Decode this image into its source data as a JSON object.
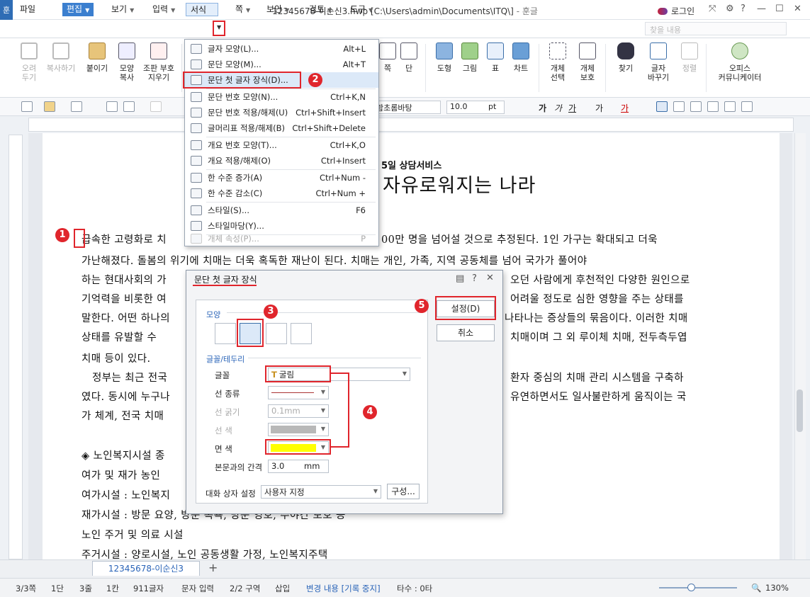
{
  "window": {
    "title_main": "12345678-이순신3.hwp [C:\\Users\\admin\\Documents\\ITQ\\]",
    "title_app": "- 훈글",
    "app_icon": "훈",
    "login": "로그인",
    "controls": [
      "⤧",
      "⚙",
      "?",
      "—",
      "☐",
      "✕"
    ]
  },
  "menu": {
    "items": [
      "파일",
      "편집",
      "보기",
      "입력",
      "서식",
      "쪽",
      "보안",
      "검토",
      "도구"
    ],
    "search_placeholder": "찾을 내용"
  },
  "ribbon": {
    "left": [
      "오려\n두기",
      "복사하기",
      "붙이기",
      "모양\n복사",
      "조판 부호\n지우기"
    ],
    "mid": [
      "쪽",
      "단"
    ],
    "right": [
      "도형",
      "그림",
      "표",
      "차트",
      "개체\n선택",
      "개체\n보호",
      "찾기",
      "글자\n바꾸기",
      "정렬",
      "오피스\n커뮤니케이터"
    ],
    "zoom_icon_label": "fx"
  },
  "format_bar": {
    "font": "함초롬바탕",
    "size": "10.0",
    "unit": "pt",
    "styles": [
      "가",
      "가",
      "가",
      "가",
      "가"
    ]
  },
  "format_menu": {
    "items": [
      {
        "label": "글자 모양(L)...",
        "shortcut": "Alt+L",
        "icon": "font-shape-icon"
      },
      {
        "label": "문단 모양(M)...",
        "shortcut": "Alt+T",
        "icon": "paragraph-shape-icon"
      },
      {
        "label": "문단 첫 글자 장식(D)...",
        "shortcut": "",
        "icon": "drop-cap-icon"
      },
      {
        "label": "문단 번호 모양(N)...",
        "shortcut": "Ctrl+K,N",
        "icon": "paragraph-number-icon"
      },
      {
        "label": "문단 번호 적용/해제(U)",
        "shortcut": "Ctrl+Shift+Insert",
        "icon": "numbering-toggle-icon"
      },
      {
        "label": "글머리표 적용/해제(B)",
        "shortcut": "Ctrl+Shift+Delete",
        "icon": "bullet-toggle-icon"
      },
      {
        "label": "개요 번호 모양(T)...",
        "shortcut": "Ctrl+K,O",
        "icon": "outline-number-icon"
      },
      {
        "label": "개요 적용/해제(O)",
        "shortcut": "Ctrl+Insert",
        "icon": "outline-toggle-icon"
      },
      {
        "label": "한 수준 증가(A)",
        "shortcut": "Ctrl+Num -",
        "icon": "level-up-icon"
      },
      {
        "label": "한 수준 감소(C)",
        "shortcut": "Ctrl+Num +",
        "icon": "level-down-icon"
      },
      {
        "label": "스타일(S)...",
        "shortcut": "F6",
        "icon": "style-icon"
      },
      {
        "label": "스타일마당(Y)...",
        "shortcut": "",
        "icon": "style-gallery-icon"
      },
      {
        "label": "개체 속성(P)...",
        "shortcut": "P",
        "icon": "object-properties-icon"
      }
    ]
  },
  "document": {
    "heading_small": "5일 상담서비스",
    "heading_big": "자유로워지는 나라",
    "lines": [
      "급속한 고령화로 치",
      "가난해졌다. 돌봄의 위기에 치매는 더욱 혹독한 재난이 된다. 치매는 개인, 가족, 지역 공동체를 넘어 국가가 풀어야",
      "하는 현대사회의 가",
      "기억력을 비롯한 여",
      "말한다. 어떤 하나의",
      "상태를 유발할 수",
      "치매 등이 있다.",
      "정부는 최근 전국",
      "였다. 동시에 누구나",
      "가 체계, 전국 치매",
      "◈ 노인복지시설 종",
      "여가 및 재가 농인",
      "여가시설 : 노인복지",
      "재가시설 : 방문 요양, 방문 목욕, 방문 영호, 주야간 보호 등",
      "노인 주거 및 의료 시설",
      "주거시설 : 양로시설, 노인 공동생활 가정, 노인복지주택"
    ],
    "right_fragments": [
      "00만 명을 넘어설 것으로 추정된다. 1인 가구는 확대되고 더욱",
      "오던 사람에게 후천적인 다양한 원인으로",
      "어려울 정도로 심한 영향을 주는 상태를",
      "나타나는 증상들의 묶음이다. 이러한 치매",
      "치매이며 그 외 루이체 치매, 전두측두엽",
      "환자 중심의 치매 관리 시스템을 구축하",
      "유연하면서도 일사불란하게 움직이는 국"
    ]
  },
  "dialog": {
    "title": "문단 첫 글자 장식",
    "shape_section": "모양",
    "border_section": "글꼴/테두리",
    "font_label": "글꼴",
    "font_value": "굴림",
    "line_type_label": "선 종류",
    "line_width_label": "선 굵기",
    "line_width_value": "0.1mm",
    "line_color_label": "선 색",
    "fill_label": "면 색",
    "fill_color": "#ffff00",
    "gap_label": "본문과의 간격",
    "gap_value": "3.0",
    "gap_unit": "mm",
    "dialog_setting_label": "대화 상자 설정",
    "dialog_setting_value": "사용자 지정",
    "config_button": "구성...",
    "ok_button": "설정(D)",
    "cancel_button": "취소"
  },
  "annotations": [
    "1",
    "2",
    "3",
    "4",
    "5"
  ],
  "tabs": {
    "doc_tab": "12345678-이순신3",
    "add": "+"
  },
  "status": {
    "page": "3/3쪽",
    "column": "1단",
    "line": "3줄",
    "cell": "1칸",
    "chars": "911글자",
    "mode": "문자 입력",
    "section": "2/2 구역",
    "insert": "삽입",
    "track": "변경 내용 [기록 중지]",
    "typing": "타수 : 0타",
    "zoom": "130%"
  },
  "colors": {
    "accent": "#3b7fcf",
    "annotation": "#e0252c"
  }
}
